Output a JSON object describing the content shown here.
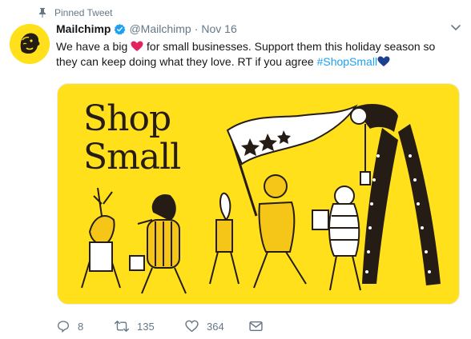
{
  "pinned": {
    "label": "Pinned Tweet",
    "icon": "pin-icon"
  },
  "author": {
    "name": "Mailchimp",
    "handle": "@Mailchimp",
    "separator": "·",
    "date": "Nov 16",
    "verified": true,
    "avatar_icon": "mailchimp-freddie-logo"
  },
  "tweet": {
    "text_part1": "We have a big ",
    "heart_emoji": "❤️",
    "text_part2": " for small businesses. Support them this holiday season so they can keep doing what they love. RT if you agree ",
    "hashtag": "#ShopSmall",
    "blue_heart_emoji": "💙"
  },
  "media": {
    "headline_line1": "Shop",
    "headline_line2": "Small",
    "background_color": "#ffe01b",
    "ink_color": "#241c15"
  },
  "actions": {
    "reply_count": "8",
    "retweet_count": "135",
    "like_count": "364"
  },
  "colors": {
    "text": "#14171a",
    "muted": "#657786",
    "link": "#1da1f2",
    "heart_red": "#e0245e",
    "heart_blue": "#1c3f8f"
  }
}
